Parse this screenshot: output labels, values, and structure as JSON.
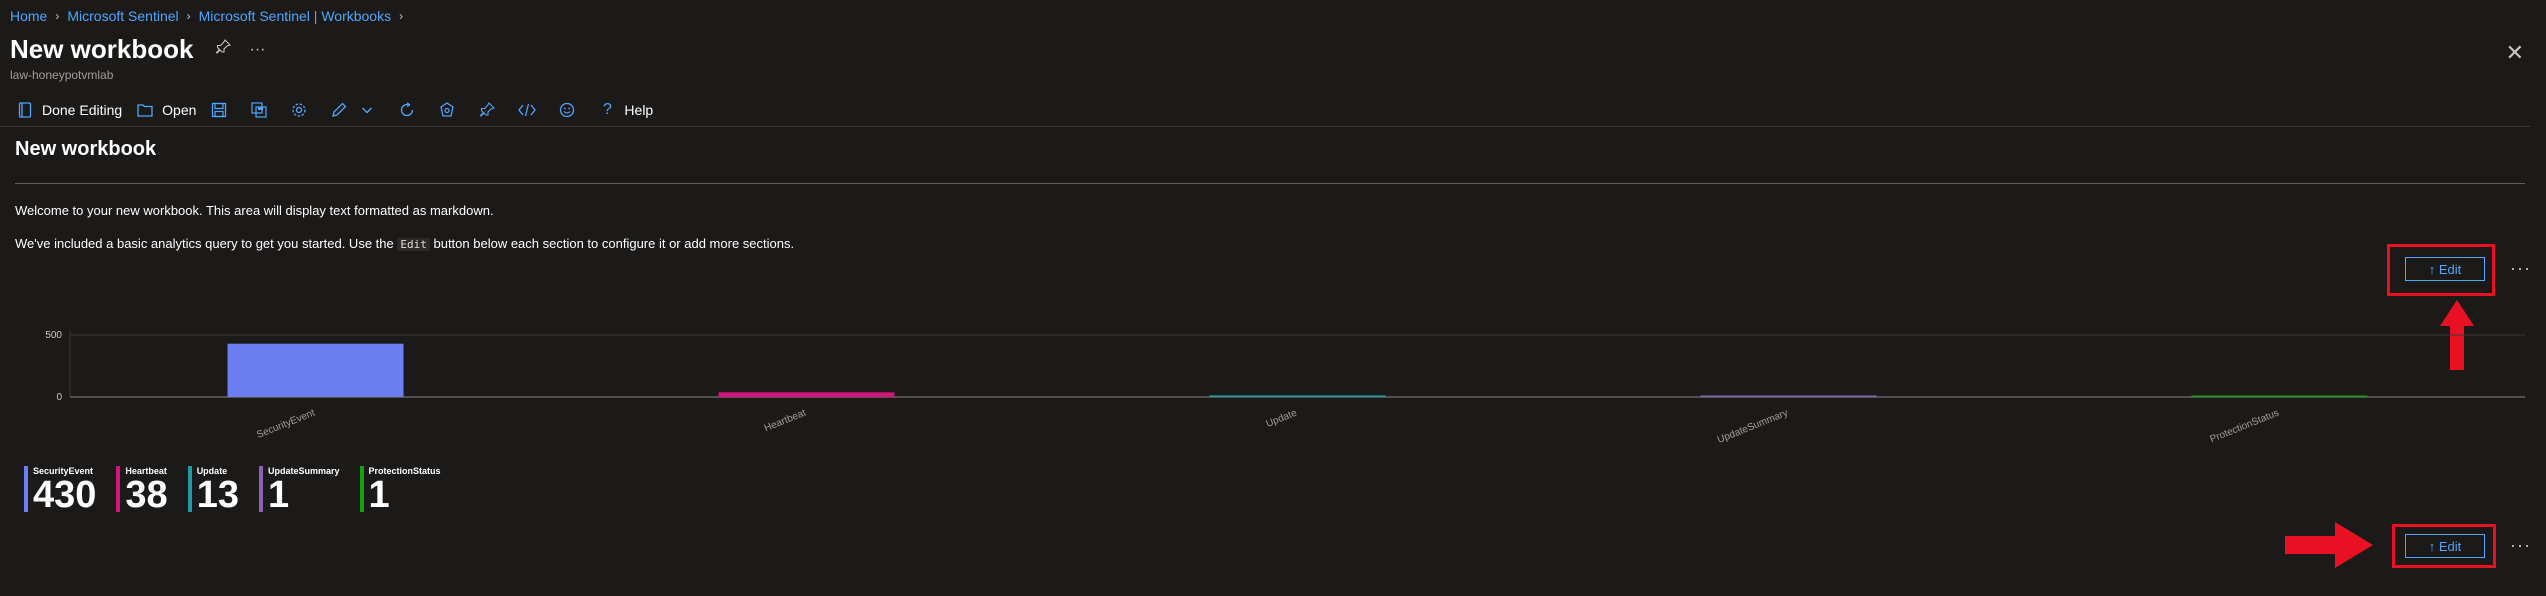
{
  "breadcrumb": [
    "Home",
    "Microsoft Sentinel",
    "Microsoft Sentinel | Workbooks"
  ],
  "header": {
    "title": "New workbook",
    "subtitle": "law-honeypotvmlab",
    "pin_icon": "pin-icon",
    "more_icon": "more-icon",
    "close_icon": "close-icon",
    "more_label": "···",
    "close_label": "✕"
  },
  "toolbar": {
    "done_editing_label": "Done Editing",
    "open_label": "Open",
    "help_label": "Help",
    "icons": [
      "done-editing-icon",
      "open-icon",
      "save-icon",
      "save-as-icon",
      "settings-icon",
      "edit-icon",
      "chevron-down-icon",
      "refresh-icon",
      "share-icon",
      "pin-icon",
      "code-icon",
      "feedback-icon",
      "help-icon"
    ]
  },
  "workbook": {
    "title": "New workbook",
    "line1": "Welcome to your new workbook. This area will display text formatted as markdown.",
    "line2_pre": "We've included a basic analytics query to get you started. Use the",
    "line2_code": "Edit",
    "line2_post": "button below each section to configure it or add more sections."
  },
  "edit_buttons": {
    "label": "↑ Edit",
    "more_label": "···"
  },
  "chart_data": {
    "type": "bar",
    "categories": [
      "SecurityEvent",
      "Heartbeat",
      "Update",
      "UpdateSummary",
      "ProtectionStatus"
    ],
    "values": [
      430,
      38,
      13,
      1,
      1
    ],
    "yticks": [
      0,
      500
    ],
    "ylim": [
      0,
      500
    ],
    "colors": [
      "#6b7ff0",
      "#d6137b",
      "#1e9ca0",
      "#8764b8",
      "#13a10e"
    ],
    "title": "",
    "xlabel": "",
    "ylabel": ""
  },
  "tiles": [
    {
      "label": "SecurityEvent",
      "value": "430",
      "color": "#6b7ff0"
    },
    {
      "label": "Heartbeat",
      "value": "38",
      "color": "#d6137b"
    },
    {
      "label": "Update",
      "value": "13",
      "color": "#1e9ca0"
    },
    {
      "label": "UpdateSummary",
      "value": "1",
      "color": "#8764b8"
    },
    {
      "label": "ProtectionStatus",
      "value": "1",
      "color": "#13a10e"
    }
  ],
  "colors": {
    "accent": "#4ea6ff",
    "highlight": "#e81123",
    "background": "#1b1a19"
  }
}
